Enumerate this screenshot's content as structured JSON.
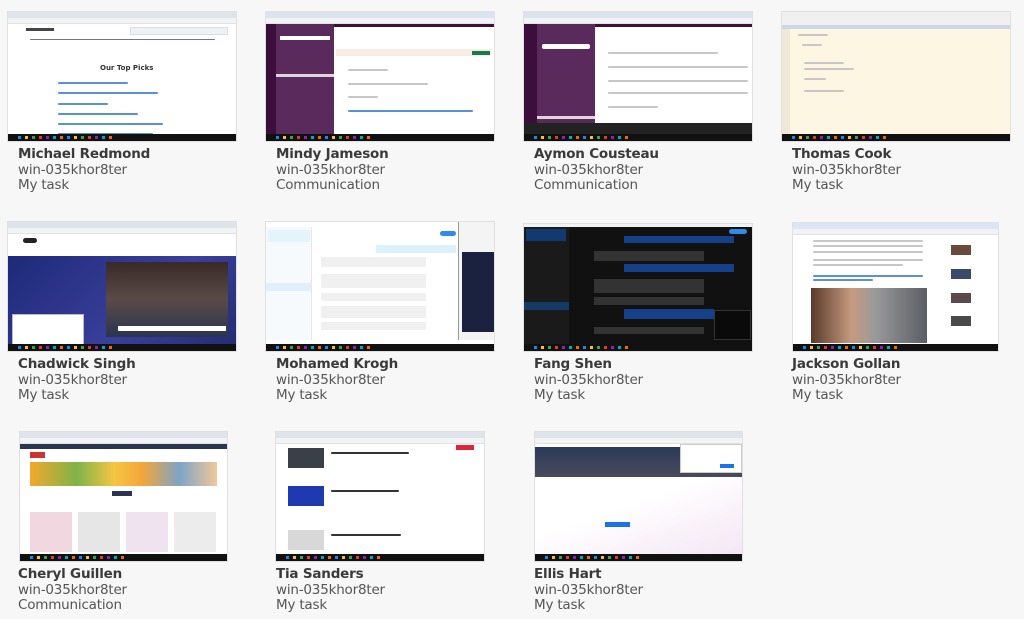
{
  "sessions": [
    {
      "name": "Michael Redmond",
      "host": "win-035khor8ter",
      "task": "My task",
      "thumbnail": "browser-top-picks-list"
    },
    {
      "name": "Mindy Jameson",
      "host": "win-035khor8ter",
      "task": "Communication",
      "thumbnail": "slack-purple-chat"
    },
    {
      "name": "Aymon Cousteau",
      "host": "win-035khor8ter",
      "task": "Communication",
      "thumbnail": "slack-purple-channel"
    },
    {
      "name": "Thomas Cook",
      "host": "win-035khor8ter",
      "task": "My task",
      "thumbnail": "code-editor"
    },
    {
      "name": "Chadwick Singh",
      "host": "win-035khor8ter",
      "task": "My task",
      "thumbnail": "news-video-page"
    },
    {
      "name": "Mohamed Krogh",
      "host": "win-035khor8ter",
      "task": "My task",
      "thumbnail": "light-messenger"
    },
    {
      "name": "Fang Shen",
      "host": "win-035khor8ter",
      "task": "My task",
      "thumbnail": "dark-messenger"
    },
    {
      "name": "Jackson Gollan",
      "host": "win-035khor8ter",
      "task": "My task",
      "thumbnail": "news-article-photo"
    },
    {
      "name": "Cheryl Guillen",
      "host": "win-035khor8ter",
      "task": "Communication",
      "thumbnail": "fashion-store"
    },
    {
      "name": "Tia Sanders",
      "host": "win-035khor8ter",
      "task": "My task",
      "thumbnail": "tech-news-list"
    },
    {
      "name": "Ellis Hart",
      "host": "win-035khor8ter",
      "task": "My task",
      "thumbnail": "browser-new-tab"
    }
  ],
  "thumb_text": {
    "top_picks_heading": "Our Top Picks"
  },
  "colors": {
    "background": "#f7f7f7",
    "name_text": "#3a3a3a",
    "meta_text": "#555555",
    "slack_purple": "#4a154b",
    "taskbar": "#111111"
  }
}
